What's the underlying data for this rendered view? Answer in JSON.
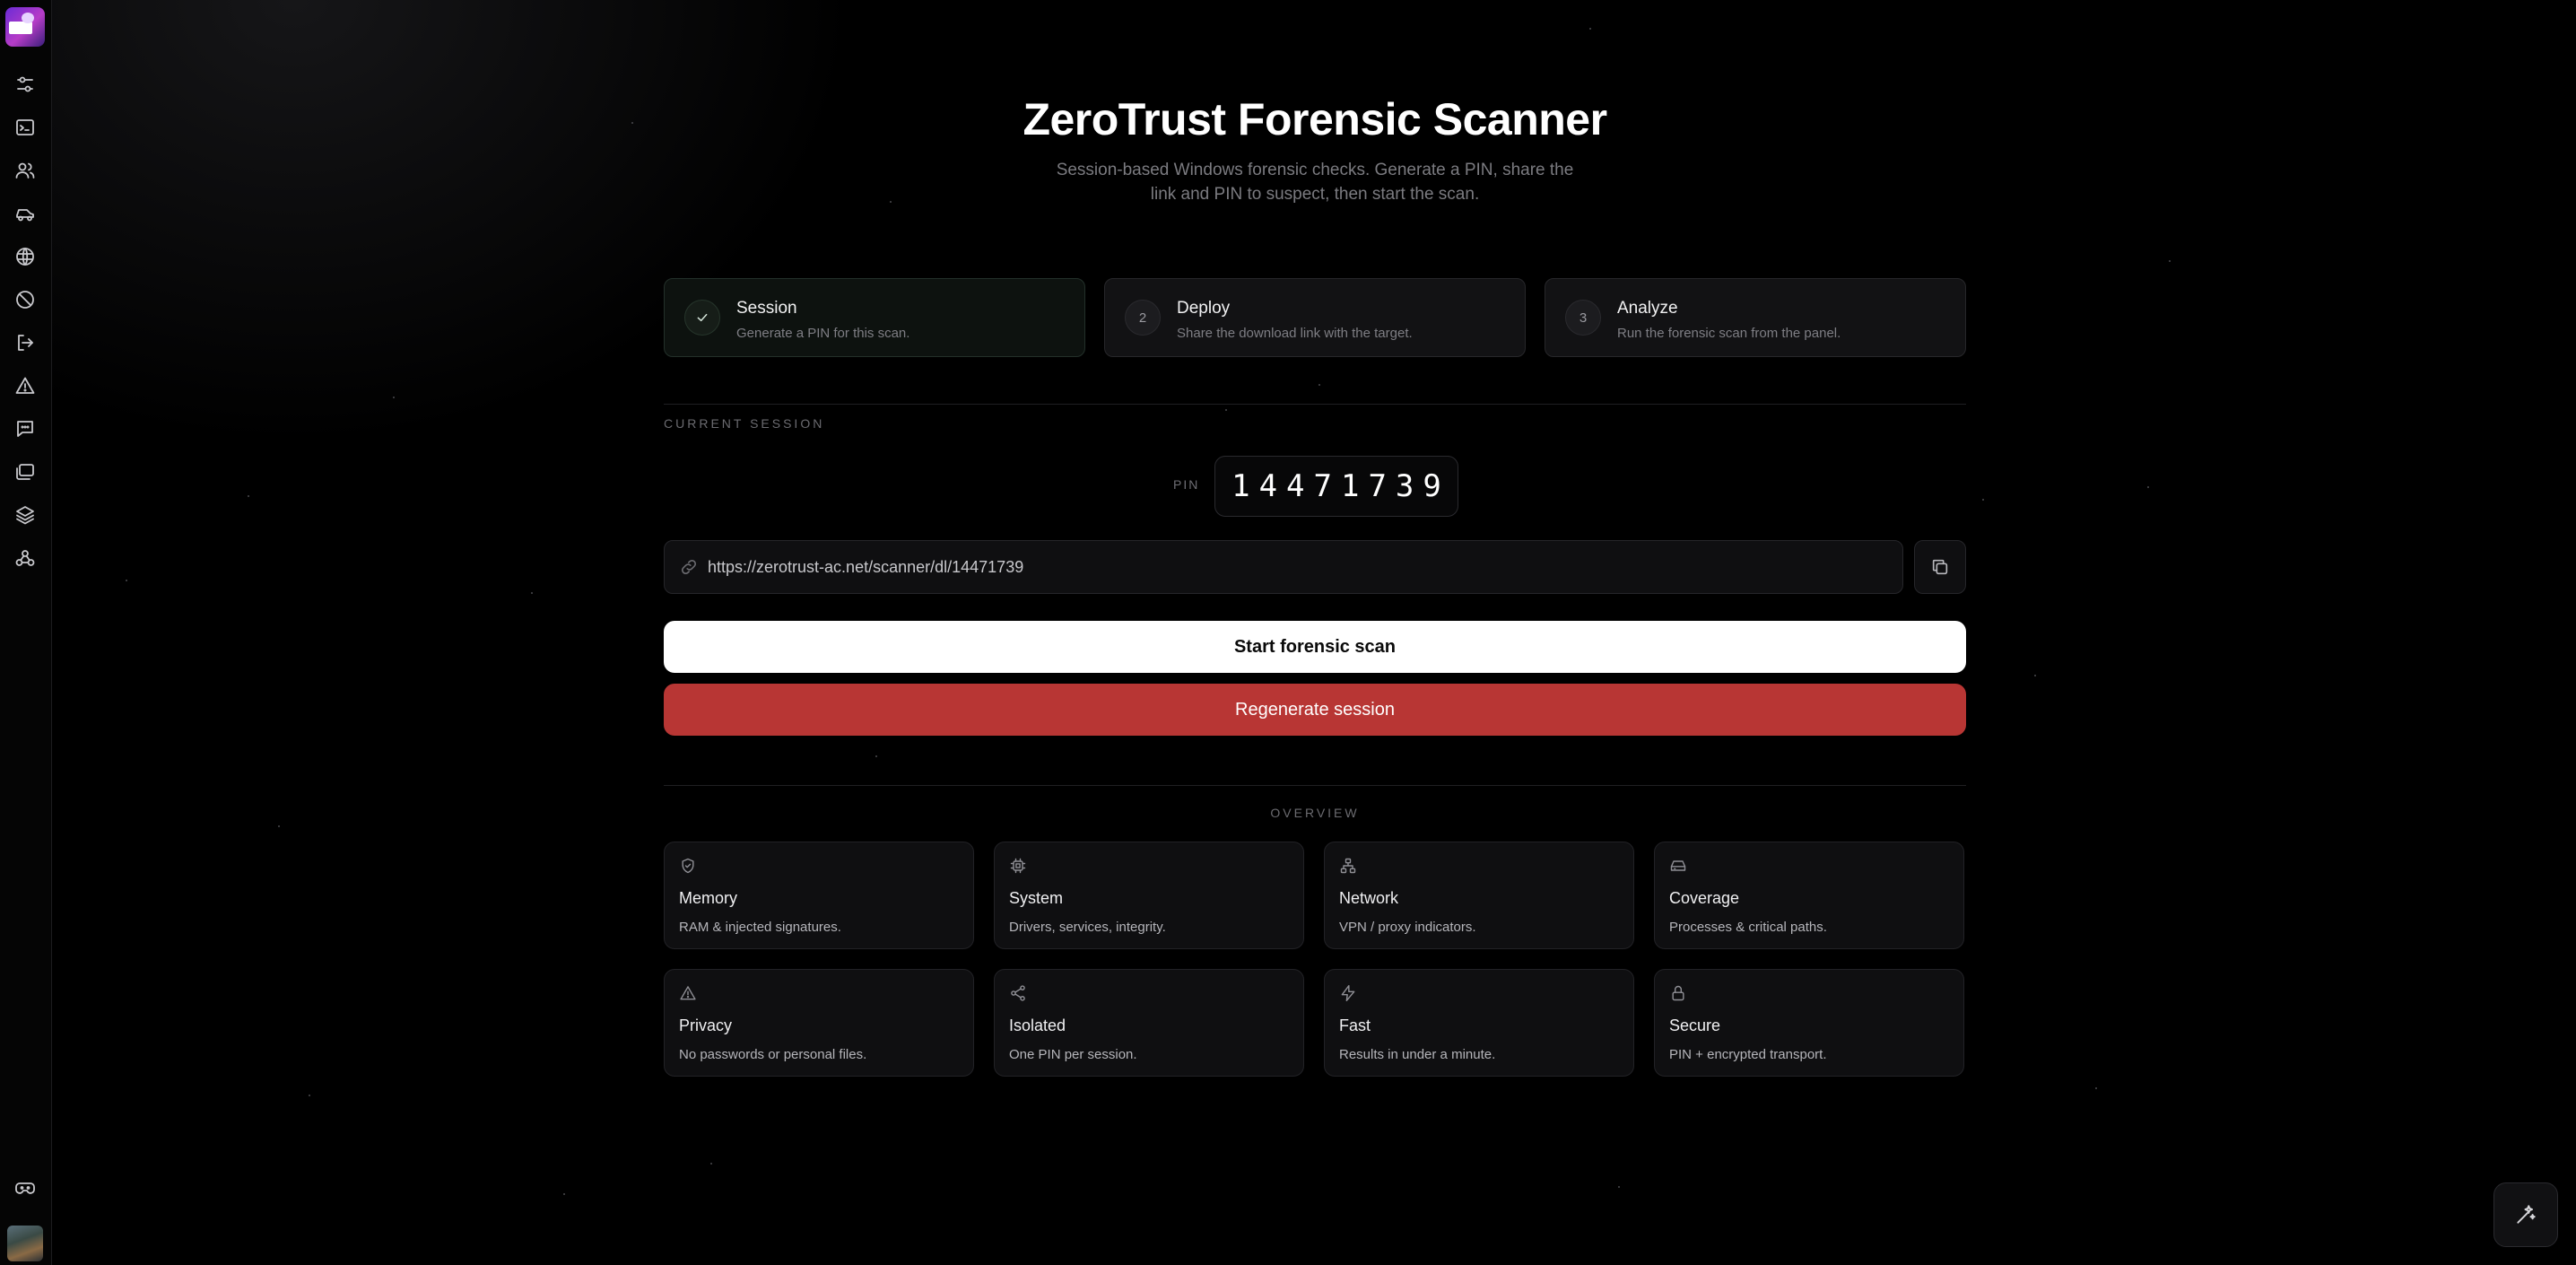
{
  "header": {
    "title": "ZeroTrust Forensic Scanner",
    "subtitle": "Session-based Windows forensic checks. Generate a PIN, share the link and PIN to suspect, then start the scan."
  },
  "steps": [
    {
      "badge": "",
      "title": "Session",
      "description": "Generate a PIN for this scan.",
      "status": "done"
    },
    {
      "badge": "2",
      "title": "Deploy",
      "description": "Share the download link with the target.",
      "status": "pending"
    },
    {
      "badge": "3",
      "title": "Analyze",
      "description": "Run the forensic scan from the panel.",
      "status": "pending"
    }
  ],
  "session": {
    "section_label": "CURRENT SESSION",
    "pin_label": "PIN",
    "pin": "14471739",
    "url": "https://zerotrust-ac.net/scanner/dl/14471739"
  },
  "actions": {
    "start_label": "Start forensic scan",
    "regenerate_label": "Regenerate session"
  },
  "overview": {
    "label": "OVERVIEW",
    "cards": [
      {
        "icon": "shield-check-icon",
        "title": "Memory",
        "description": "RAM & injected signatures."
      },
      {
        "icon": "cpu-icon",
        "title": "System",
        "description": "Drivers, services, integrity."
      },
      {
        "icon": "network-icon",
        "title": "Network",
        "description": "VPN / proxy indicators."
      },
      {
        "icon": "hard-drive-icon",
        "title": "Coverage",
        "description": "Processes & critical paths."
      },
      {
        "icon": "warning-icon",
        "title": "Privacy",
        "description": "No passwords or personal files."
      },
      {
        "icon": "share-icon",
        "title": "Isolated",
        "description": "One PIN per session."
      },
      {
        "icon": "bolt-icon",
        "title": "Fast",
        "description": "Results in under a minute."
      },
      {
        "icon": "lock-icon",
        "title": "Secure",
        "description": "PIN + encrypted transport."
      }
    ]
  },
  "sidebar": {
    "icons": [
      "sliders-icon",
      "terminal-icon",
      "users-icon",
      "truck-icon",
      "globe-icon",
      "ban-icon",
      "logout-icon",
      "alert-triangle-icon",
      "message-icon",
      "folders-icon",
      "layers-icon",
      "webhook-icon",
      "gamepad-icon"
    ]
  },
  "colors": {
    "background": "#000000",
    "danger": "#b83634",
    "primary_button": "#ffffff"
  }
}
